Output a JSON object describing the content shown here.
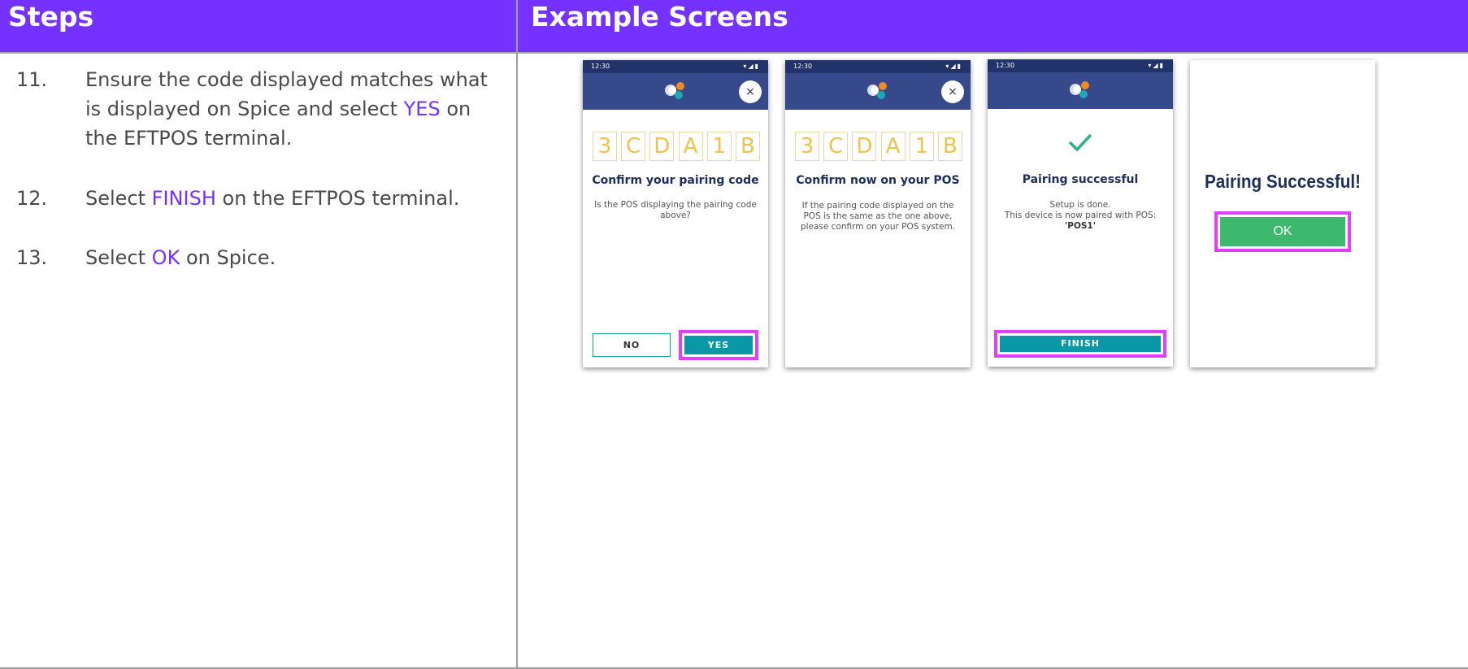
{
  "headers": {
    "steps": "Steps",
    "screens": "Example Screens"
  },
  "steps": [
    {
      "num": "11.",
      "before": "Ensure the code displayed matches what is displayed on Spice and select ",
      "highlight": "YES",
      "after": " on the EFTPOS terminal."
    },
    {
      "num": "12.",
      "before": "Select ",
      "highlight": "FINISH",
      "after": " on the EFTPOS terminal."
    },
    {
      "num": "13.",
      "before": "Select ",
      "highlight": "OK",
      "after": " on Spice."
    }
  ],
  "screens": {
    "status_time": "12:30",
    "close_symbol": "×",
    "pairing_code": [
      "3",
      "C",
      "D",
      "A",
      "1",
      "B"
    ],
    "screen1": {
      "title": "Confirm your pairing code",
      "body": "Is the POS displaying the pairing code above?",
      "no_label": "NO",
      "yes_label": "YES"
    },
    "screen2": {
      "title": "Confirm now on your POS",
      "body": "If the pairing code displayed on the POS is the same as the one above, please confirm on your POS system."
    },
    "screen3": {
      "title": "Pairing successful",
      "body_line1": "Setup is done.",
      "body_line2": "This device is now paired with POS:",
      "pos_name": "'POS1'",
      "finish_label": "FINISH"
    },
    "screen4": {
      "title": "Pairing Successful!",
      "ok_label": "OK"
    }
  },
  "colors": {
    "header_bg": "#7531ff",
    "highlight": "#7531ff",
    "appbar": "#36498a",
    "code_digit": "#f2c24e",
    "teal_button": "#0a98a6",
    "ok_button": "#3cb86f",
    "selection_frame": "#e040fb"
  }
}
